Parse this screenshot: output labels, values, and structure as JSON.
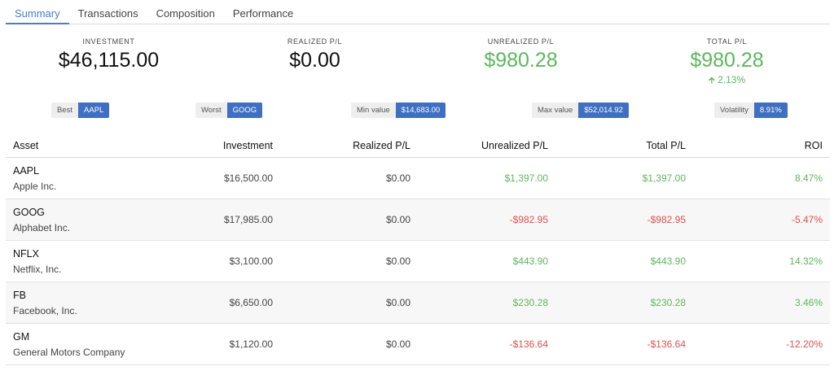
{
  "tabs": [
    {
      "label": "Summary"
    },
    {
      "label": "Transactions"
    },
    {
      "label": "Composition"
    },
    {
      "label": "Performance"
    }
  ],
  "stats": {
    "investment": {
      "label": "INVESTMENT",
      "value": "$46,115.00"
    },
    "realized": {
      "label": "REALIZED P/L",
      "value": "$0.00"
    },
    "unrealized": {
      "label": "UNREALIZED P/L",
      "value": "$980.28"
    },
    "total": {
      "label": "TOTAL P/L",
      "value": "$980.28",
      "change": "2.13%"
    }
  },
  "badges": {
    "best": {
      "label": "Best",
      "value": "AAPL"
    },
    "worst": {
      "label": "Worst",
      "value": "GOOG"
    },
    "min": {
      "label": "Min value",
      "value": "$14,683.00"
    },
    "max": {
      "label": "Max value",
      "value": "$52,014.92"
    },
    "volatility": {
      "label": "Volatility",
      "value": "8.91%"
    }
  },
  "table": {
    "headers": {
      "asset": "Asset",
      "investment": "Investment",
      "realized": "Realized P/L",
      "unrealized": "Unrealized P/L",
      "total": "Total P/L",
      "roi": "ROI"
    },
    "rows": [
      {
        "symbol": "AAPL",
        "name": "Apple Inc.",
        "investment": "$16,500.00",
        "realized": "$0.00",
        "unrealized": "$1,397.00",
        "total": "$1,397.00",
        "roi": "8.47%"
      },
      {
        "symbol": "GOOG",
        "name": "Alphabet Inc.",
        "investment": "$17,985.00",
        "realized": "$0.00",
        "unrealized": "-$982.95",
        "total": "-$982.95",
        "roi": "-5.47%"
      },
      {
        "symbol": "NFLX",
        "name": "Netflix, Inc.",
        "investment": "$3,100.00",
        "realized": "$0.00",
        "unrealized": "$443.90",
        "total": "$443.90",
        "roi": "14.32%"
      },
      {
        "symbol": "FB",
        "name": "Facebook, Inc.",
        "investment": "$6,650.00",
        "realized": "$0.00",
        "unrealized": "$230.28",
        "total": "$230.28",
        "roi": "3.46%"
      },
      {
        "symbol": "GM",
        "name": "General Motors Company",
        "investment": "$1,120.00",
        "realized": "$0.00",
        "unrealized": "-$136.64",
        "total": "-$136.64",
        "roi": "-12.20%"
      }
    ]
  },
  "colors": {
    "accent": "#4a7cc9",
    "badge": "#3e6fc2",
    "positive": "#5cb85c",
    "negative": "#d9534f"
  }
}
